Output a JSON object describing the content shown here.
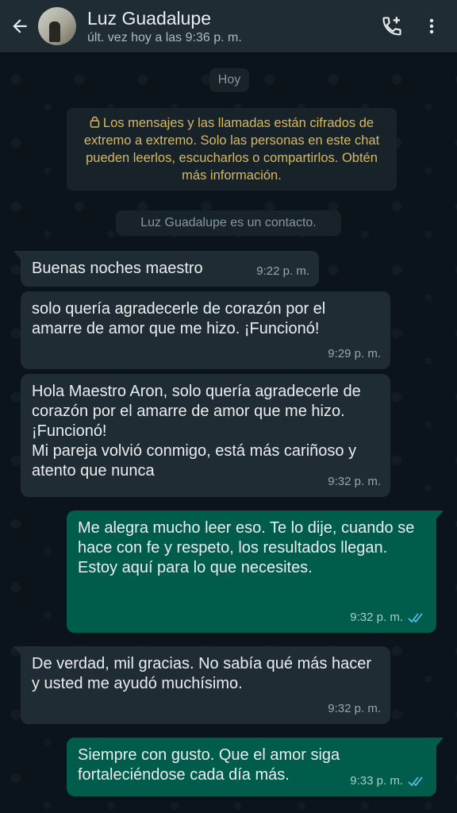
{
  "header": {
    "contact_name": "Luz Guadalupe",
    "status": "últ. vez hoy a las 9:36 p. m.",
    "icons": [
      "back-arrow-icon",
      "avatar",
      "add-call-icon",
      "more-vertical-icon"
    ]
  },
  "chat": {
    "date_separator": "Hoy",
    "encryption_notice": "Los mensajes y las llamadas están cifrados de extremo a extremo. Solo las personas en este chat pueden leerlos, escucharlos o compartirlos. Obtén más información.",
    "contact_notice": "Luz Guadalupe es un contacto.",
    "messages": [
      {
        "direction": "in",
        "text": "Buenas noches maestro",
        "time": "9:22 p. m."
      },
      {
        "direction": "in",
        "text": "solo quería agradecerle de corazón por el amarre de amor que me hizo. ¡Funcionó!",
        "time": "9:29 p. m."
      },
      {
        "direction": "in",
        "text": "Hola Maestro Aron, solo quería agradecerle de corazón por el amarre de amor que me hizo. ¡Funcionó!\nMi pareja volvió conmigo, está más cariñoso y atento que nunca",
        "time": "9:32 p. m."
      },
      {
        "direction": "out",
        "text": "Me alegra mucho leer eso. Te lo dije, cuando se hace con fe y respeto, los resultados llegan.\nEstoy aquí para lo que necesites.",
        "time": "9:32 p. m.",
        "status": "read"
      },
      {
        "direction": "in",
        "text": "De verdad, mil gracias. No sabía qué más hacer y usted me ayudó muchísimo.",
        "time": "9:32 p. m."
      },
      {
        "direction": "out",
        "text": "Siempre con gusto. Que el amor siga fortaleciéndose cada día más.",
        "time": "9:33 p. m.",
        "status": "read"
      }
    ]
  },
  "colors": {
    "background": "#0b141a",
    "header": "#1f2c34",
    "incoming_bubble": "#202c33",
    "outgoing_bubble": "#005c4b",
    "notice_text": "#d8b85c",
    "read_ticks": "#53bdeb"
  }
}
